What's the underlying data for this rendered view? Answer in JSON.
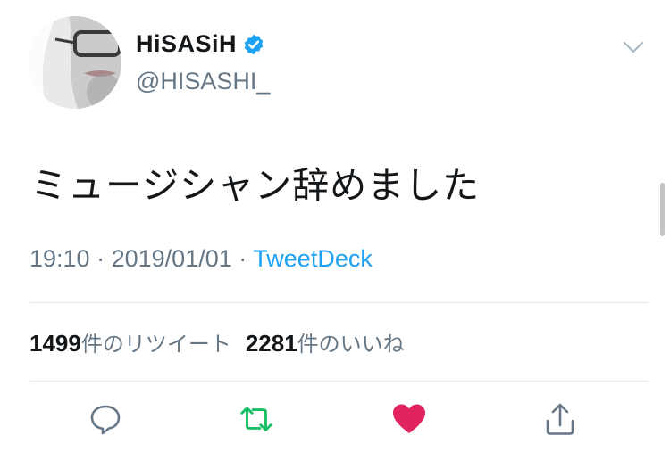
{
  "user": {
    "display_name": "HiSASiH",
    "handle": "@HISASHI_",
    "verified": true,
    "avatar_icon": "user-avatar"
  },
  "tweet": {
    "text": "ミュージシャン辞めました",
    "time": "19:10",
    "date": "2019/01/01",
    "separator": "·",
    "source": "TweetDeck"
  },
  "stats": {
    "retweets_count": "1499",
    "retweets_label": "件のリツイート",
    "likes_count": "2281",
    "likes_label": "件のいいね"
  },
  "actions": {
    "reply_icon": "reply-icon",
    "retweet_icon": "retweet-icon",
    "like_icon": "heart-icon",
    "share_icon": "share-icon"
  },
  "colors": {
    "link": "#1da1f2",
    "secondary_text": "#657786",
    "retweet_green": "#17bf63",
    "like_red": "#e0245e",
    "icon_gray": "#657786"
  }
}
